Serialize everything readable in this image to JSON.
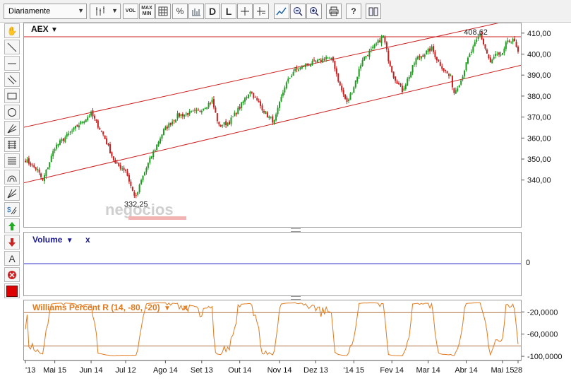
{
  "toolbar": {
    "period_select": "Diariamente",
    "buttons": [
      "candle-type-icon",
      "vol-toggle",
      "maxmin-toggle",
      "grid-icon",
      "percent-icon",
      "bars-icon",
      "d-button",
      "l-button",
      "crosshair-icon",
      "crosshair-label-icon",
      "zoom-fit-icon",
      "zoom-out-icon",
      "zoom-in-icon",
      "print-icon",
      "help-icon",
      "book-icon"
    ],
    "vol_label": "VOL",
    "max_label": "MAX",
    "min_label": "MIN",
    "d_label": "D",
    "l_label": "L",
    "percent_label": "%",
    "help_label": "?"
  },
  "sidebar_tools": [
    "hand-icon",
    "line-icon",
    "horizontal-line-icon",
    "parallel-lines-icon",
    "rectangle-icon",
    "circle-icon",
    "pitchfork-icon",
    "fib-retracement-icon",
    "fib-fan-icon",
    "arc-icon",
    "gann-icon",
    "dollar-icon",
    "buy-arrow-icon",
    "sell-arrow-icon",
    "text-icon",
    "delete-icon",
    "color-swatch"
  ],
  "sidebar_text_label": "A",
  "colors": {
    "up": "#1e9a1e",
    "down": "#c81e1e",
    "channel": "#cc2222",
    "volume_line": "#3333cc",
    "williams": "#e07a1e",
    "title_blue": "#1a1a8c"
  },
  "watermark": "negocios",
  "chart_data": [
    {
      "type": "candlestick",
      "title": "AEX",
      "title_suffix": "▼",
      "ylim": [
        318,
        415
      ],
      "yticks": [
        340,
        350,
        360,
        370,
        380,
        390,
        400,
        410
      ],
      "ytick_labels": [
        "340,00",
        "350,00",
        "360,00",
        "370,00",
        "380,00",
        "390,00",
        "400,00",
        "410,00"
      ],
      "annotations": [
        {
          "label": "408,62",
          "value": 408.62
        },
        {
          "label": "332,25",
          "value": 332.25
        }
      ],
      "reference_line": 408.62,
      "channel": {
        "upper": [
          365.5,
          417.5
        ],
        "lower": [
          339,
          395
        ]
      },
      "path_waypoints": [
        [
          0,
          350
        ],
        [
          7,
          345
        ],
        [
          10,
          340
        ],
        [
          17,
          356
        ],
        [
          30,
          366
        ],
        [
          38,
          372
        ],
        [
          45,
          362
        ],
        [
          52,
          348
        ],
        [
          58,
          345
        ],
        [
          62,
          335
        ],
        [
          64,
          332
        ],
        [
          67,
          340
        ],
        [
          72,
          350
        ],
        [
          80,
          364
        ],
        [
          88,
          371
        ],
        [
          100,
          373
        ],
        [
          108,
          378
        ],
        [
          112,
          366
        ],
        [
          118,
          368
        ],
        [
          124,
          375
        ],
        [
          130,
          383
        ],
        [
          134,
          378
        ],
        [
          140,
          371
        ],
        [
          144,
          368
        ],
        [
          150,
          385
        ],
        [
          155,
          392
        ],
        [
          162,
          395
        ],
        [
          170,
          397
        ],
        [
          174,
          399
        ],
        [
          178,
          397
        ],
        [
          182,
          385
        ],
        [
          186,
          377
        ],
        [
          190,
          385
        ],
        [
          195,
          398
        ],
        [
          201,
          403
        ],
        [
          207,
          409
        ],
        [
          210,
          398
        ],
        [
          213,
          390
        ],
        [
          218,
          383
        ],
        [
          222,
          390
        ],
        [
          226,
          398
        ],
        [
          230,
          400
        ],
        [
          235,
          403
        ],
        [
          238,
          398
        ],
        [
          242,
          393
        ],
        [
          246,
          389
        ],
        [
          248,
          382
        ],
        [
          252,
          388
        ],
        [
          256,
          398
        ],
        [
          260,
          405
        ],
        [
          263,
          410
        ],
        [
          266,
          403
        ],
        [
          269,
          396
        ],
        [
          272,
          400
        ],
        [
          275,
          399
        ],
        [
          278,
          405
        ],
        [
          282,
          408
        ],
        [
          285,
          401
        ]
      ],
      "series": []
    },
    {
      "type": "line",
      "title": "Volume",
      "title_suffix": "▼",
      "close_label": "x",
      "ylim": [
        -1,
        1
      ],
      "yticks": [
        0
      ],
      "ytick_labels": [
        "0"
      ],
      "series": [
        {
          "values": [
            0,
            0
          ]
        }
      ]
    },
    {
      "type": "line",
      "title": "Williams Percent R (14, -80, -20)",
      "title_suffix": "▼",
      "close_label": "x",
      "ylim": [
        -105,
        2
      ],
      "yticks": [
        -20,
        -60,
        -100
      ],
      "ytick_labels": [
        "-20,0000",
        "-60,0000",
        "-100,0000"
      ],
      "levels": [
        -20,
        -80
      ],
      "series": [
        {
          "values": []
        }
      ]
    }
  ],
  "x_axis": {
    "labels": [
      {
        "label": "'13",
        "day": 0
      },
      {
        "label": "Mai 15",
        "day": 17
      },
      {
        "label": "Jun 14",
        "day": 38
      },
      {
        "label": "Jul 12",
        "day": 58
      },
      {
        "label": "Ago 14",
        "day": 81
      },
      {
        "label": "Set 13",
        "day": 102
      },
      {
        "label": "Out 14",
        "day": 124
      },
      {
        "label": "Nov 14",
        "day": 147
      },
      {
        "label": "Dez 13",
        "day": 168
      },
      {
        "label": "'14 15",
        "day": 190
      },
      {
        "label": "Fev 14",
        "day": 212
      },
      {
        "label": "Mar 14",
        "day": 233
      },
      {
        "label": "Abr 14",
        "day": 255
      },
      {
        "label": "Mai 15",
        "day": 276
      },
      {
        "label": "28",
        "day": 285
      }
    ],
    "total_days": 286
  }
}
